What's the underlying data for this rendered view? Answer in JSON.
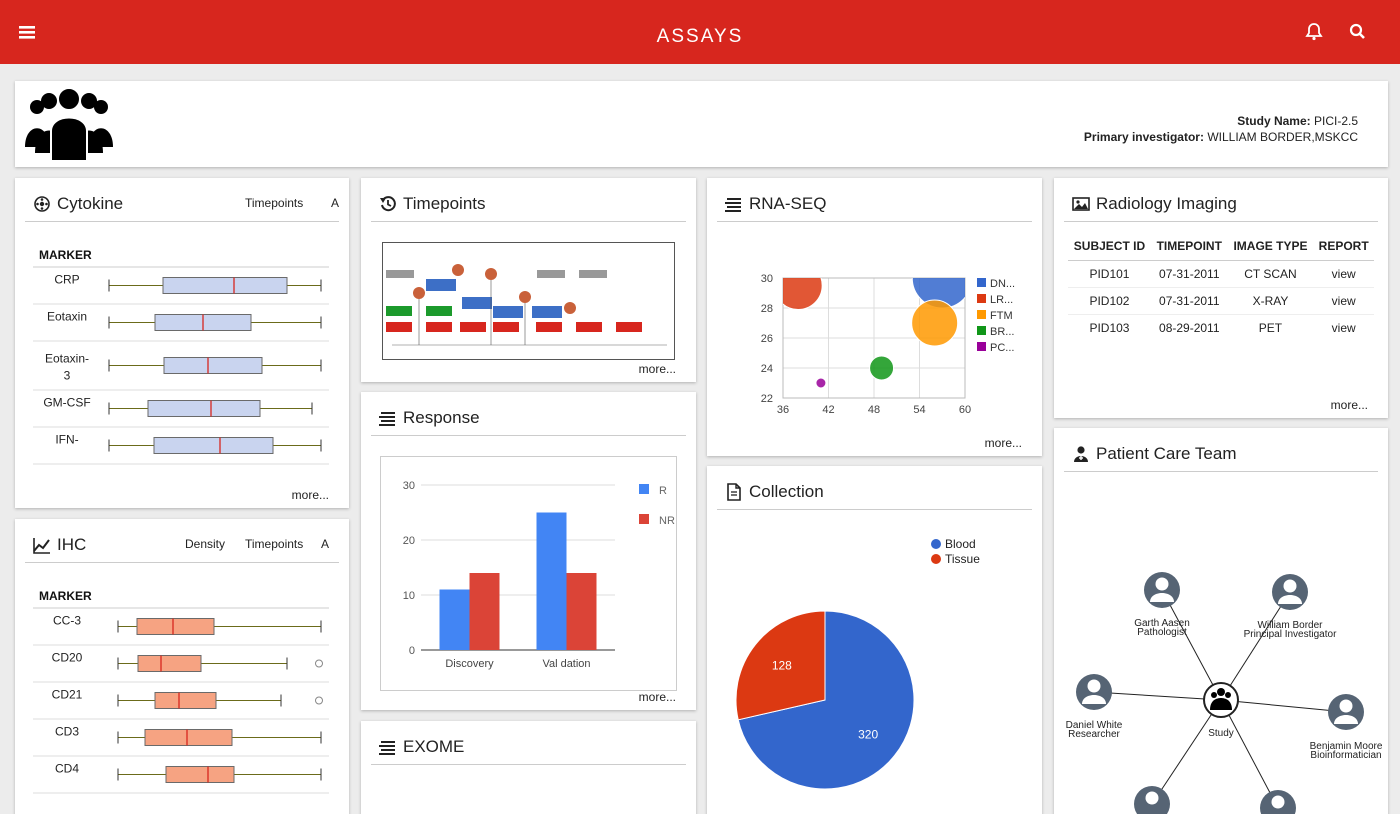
{
  "header": {
    "title": "ASSAYS",
    "menu_icon": "menu-icon",
    "bell_icon": "bell-icon",
    "search_icon": "search-icon",
    "color": "#d7261e"
  },
  "study": {
    "name_label": "Study Name:",
    "name": "PICI-2.5",
    "pi_label": "Primary investigator:",
    "pi": "WILLIAM BORDER,MSKCC"
  },
  "cytokine": {
    "title": "Cytokine",
    "tab_timepoints": "Timepoints",
    "tab_a": "A",
    "marker_header": "MARKER",
    "more": "more...",
    "markers": [
      "CRP",
      "Eotaxin",
      "Eotaxin-3",
      "GM-CSF",
      "IFN-"
    ],
    "box_color": "#c9d4ef"
  },
  "ihc": {
    "title": "IHC",
    "tab_density": "Density",
    "tab_timepoints": "Timepoints",
    "tab_a": "A",
    "marker_header": "MARKER",
    "markers": [
      "CC-3",
      "CD20",
      "CD21",
      "CD3",
      "CD4"
    ],
    "box_color": "#f6a382"
  },
  "timepoints": {
    "title": "Timepoints",
    "more": "more..."
  },
  "response": {
    "title": "Response",
    "more": "more...",
    "chart_data": {
      "type": "bar",
      "categories": [
        "Discovery",
        "Validation"
      ],
      "category_labels_shown": [
        "Discovery",
        "Val dation"
      ],
      "series": [
        {
          "name": "R",
          "values": [
            11,
            25
          ],
          "color": "#4285f4"
        },
        {
          "name": "NR",
          "values": [
            14,
            14
          ],
          "color": "#db4437"
        }
      ],
      "y_ticks": [
        "0",
        "10",
        "20",
        "30"
      ],
      "ylim": [
        0,
        30
      ]
    }
  },
  "exome": {
    "title": "EXOME"
  },
  "rnaseq": {
    "title": "RNA-SEQ",
    "more": "more...",
    "chart_data": {
      "type": "scatter",
      "x_ticks": [
        "36",
        "42",
        "48",
        "54",
        "60"
      ],
      "y_ticks": [
        "22",
        "24",
        "26",
        "28",
        "30"
      ],
      "xlim": [
        36,
        60
      ],
      "ylim": [
        22,
        30
      ],
      "series": [
        {
          "name": "DN...",
          "color": "#3366cc",
          "points": [
            {
              "x": 57,
              "y": 30,
              "size": 3
            }
          ]
        },
        {
          "name": "LR...",
          "color": "#dc3912",
          "points": [
            {
              "x": 38,
              "y": 29.5,
              "size": 2.4
            }
          ]
        },
        {
          "name": "FTM",
          "color": "#ff9900",
          "points": [
            {
              "x": 56,
              "y": 27,
              "size": 2.3
            }
          ]
        },
        {
          "name": "BR...",
          "color": "#109618",
          "points": [
            {
              "x": 49,
              "y": 24,
              "size": 1.2
            }
          ]
        },
        {
          "name": "PC...",
          "color": "#990099",
          "points": [
            {
              "x": 41,
              "y": 23,
              "size": 0.5
            }
          ]
        }
      ],
      "legend_labels_shown": [
        "DN...",
        "LR...",
        "FTM",
        "BR...",
        "PC..."
      ]
    }
  },
  "collection": {
    "title": "Collection",
    "chart_data": {
      "type": "pie",
      "slices": [
        {
          "label": "Blood",
          "value": 320,
          "color": "#3366cc"
        },
        {
          "label": "Tissue",
          "value": 128,
          "color": "#dc3912"
        }
      ]
    }
  },
  "radiology": {
    "title": "Radiology Imaging",
    "more": "more...",
    "headers": [
      "SUBJECT ID",
      "TIMEPOINT",
      "IMAGE TYPE",
      "REPORT"
    ],
    "rows": [
      [
        "PID101",
        "07-31-2011",
        "CT SCAN",
        "view"
      ],
      [
        "PID102",
        "07-31-2011",
        "X-RAY",
        "view"
      ],
      [
        "PID103",
        "08-29-2011",
        "PET",
        "view"
      ]
    ]
  },
  "careteam": {
    "title": "Patient Care Team",
    "center": "Study",
    "members": [
      {
        "name": "Garth Aasen",
        "role": "Pathologist"
      },
      {
        "name": "William Border",
        "role": "Principal Investigator"
      },
      {
        "name": "Daniel White",
        "role": "Researcher"
      },
      {
        "name": "Benjamin Moore",
        "role": "Bioinformatician"
      }
    ]
  }
}
